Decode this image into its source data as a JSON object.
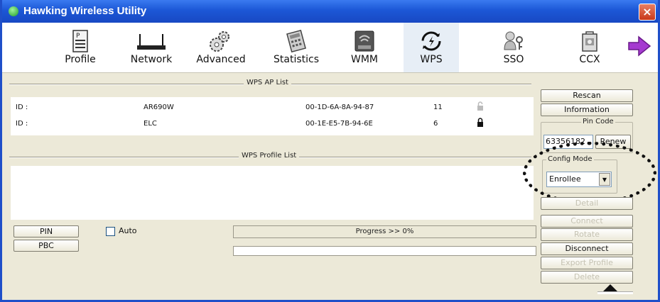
{
  "window": {
    "title": "Hawking Wireless Utility",
    "close_glyph": "×"
  },
  "toolbar": {
    "items": [
      {
        "label": "Profile",
        "icon": "profile-icon"
      },
      {
        "label": "Network",
        "icon": "network-icon"
      },
      {
        "label": "Advanced",
        "icon": "advanced-icon"
      },
      {
        "label": "Statistics",
        "icon": "statistics-icon"
      },
      {
        "label": "WMM",
        "icon": "wmm-icon"
      },
      {
        "label": "WPS",
        "icon": "wps-icon",
        "active": true
      },
      {
        "label": "SSO",
        "icon": "sso-icon"
      },
      {
        "label": "CCX",
        "icon": "ccx-icon"
      }
    ],
    "next_icon": "next-arrow-icon"
  },
  "wps_ap_list": {
    "title": "WPS AP List",
    "rows": [
      {
        "id_label": "ID :",
        "ssid": "AR690W",
        "bssid": "00-1D-6A-8A-94-87",
        "channel": "11",
        "lock": "open"
      },
      {
        "id_label": "ID :",
        "ssid": "ELC",
        "bssid": "00-1E-E5-7B-94-6E",
        "channel": "6",
        "lock": "closed"
      }
    ]
  },
  "wps_profile_list": {
    "title": "WPS Profile List"
  },
  "actions": {
    "pin": "PIN",
    "pbc": "PBC",
    "auto_label": "Auto",
    "auto_checked": false
  },
  "progress": {
    "text": "Progress >> 0%",
    "value_percent": 0
  },
  "right_panel": {
    "rescan": "Rescan",
    "information": "Information",
    "pin_code_label": "Pin Code",
    "pin_code_value": "63356182",
    "renew": "Renew",
    "config_mode_label": "Config Mode",
    "config_mode_value": "Enrollee",
    "detail": "Detail",
    "connect": "Connect",
    "rotate": "Rotate",
    "disconnect": "Disconnect",
    "export_profile": "Export Profile",
    "delete": "Delete"
  },
  "colors": {
    "titlebar": "#1c57d6",
    "window_bg": "#ece9d8",
    "highlight_ring": "#111111"
  }
}
